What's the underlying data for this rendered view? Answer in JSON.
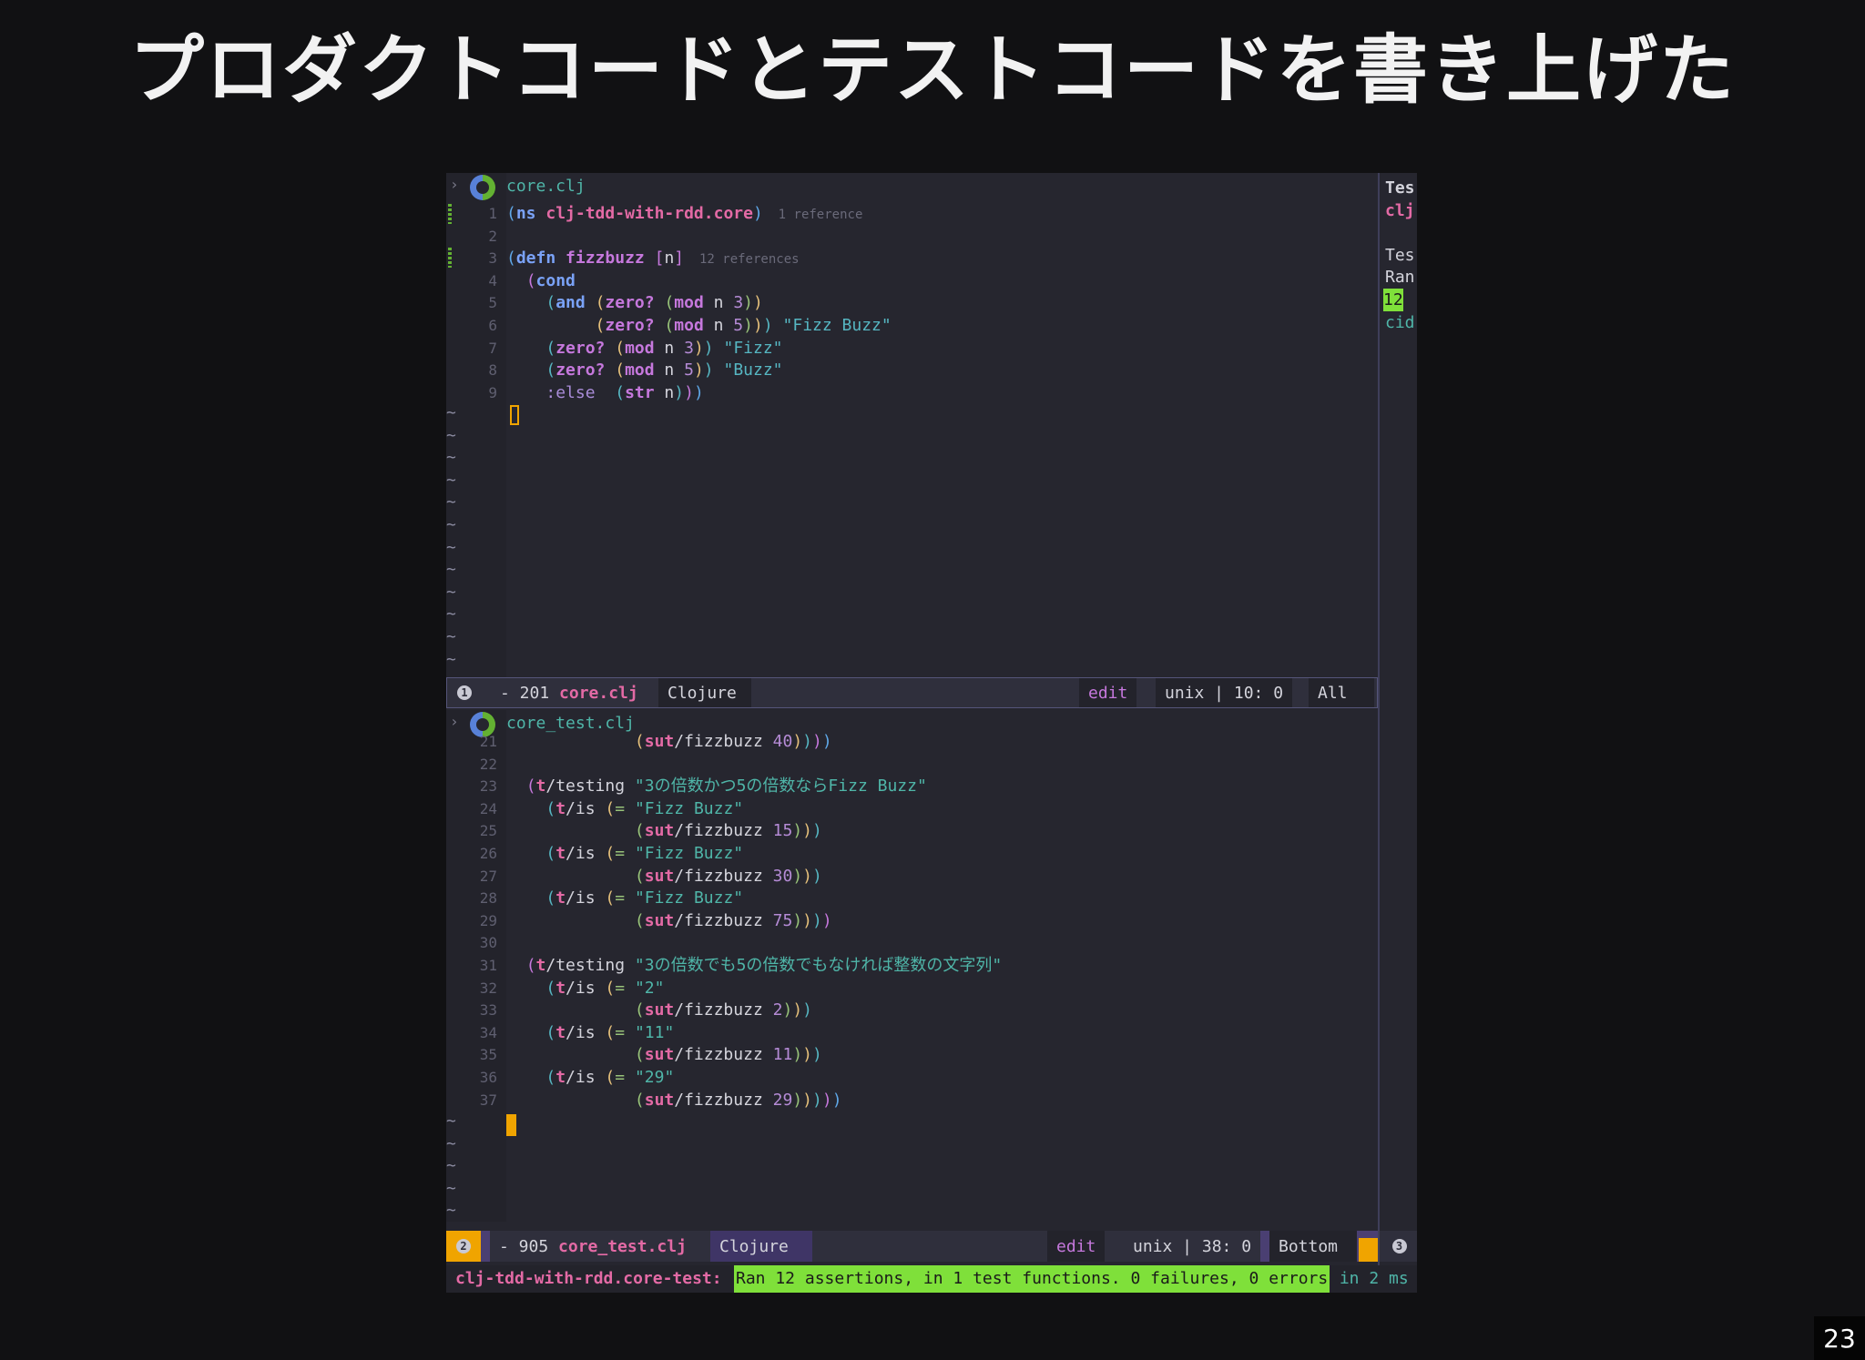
{
  "slide": {
    "title": "プロダクトコードとテストコードを書き上げた",
    "page_number": "23"
  },
  "editor": {
    "top_pane": {
      "file_name": "core.clj",
      "lines": [
        {
          "n": "1",
          "parts": [
            [
              "p1",
              "("
            ],
            [
              "k2",
              "ns"
            ],
            [
              "plain",
              " "
            ],
            [
              "ns",
              "clj-tdd-with-rdd.core"
            ],
            [
              "p1",
              ")"
            ],
            [
              "ref",
              "  1 reference"
            ]
          ]
        },
        {
          "n": "2",
          "parts": []
        },
        {
          "n": "3",
          "parts": [
            [
              "p1",
              "("
            ],
            [
              "k2",
              "defn"
            ],
            [
              "plain",
              " "
            ],
            [
              "f",
              "fizzbuzz"
            ],
            [
              "plain",
              " "
            ],
            [
              "p2",
              "["
            ],
            [
              "plain",
              "n"
            ],
            [
              "p2",
              "]"
            ],
            [
              "ref",
              "  12 references"
            ]
          ]
        },
        {
          "n": "4",
          "parts": [
            [
              "plain",
              "  "
            ],
            [
              "p2",
              "("
            ],
            [
              "k2",
              "cond"
            ]
          ]
        },
        {
          "n": "5",
          "parts": [
            [
              "plain",
              "    "
            ],
            [
              "p3",
              "("
            ],
            [
              "k2",
              "and"
            ],
            [
              "plain",
              " "
            ],
            [
              "p4",
              "("
            ],
            [
              "f",
              "zero?"
            ],
            [
              "plain",
              " "
            ],
            [
              "p5",
              "("
            ],
            [
              "f",
              "mod"
            ],
            [
              "plain",
              " n "
            ],
            [
              "num",
              "3"
            ],
            [
              "p5",
              ")"
            ],
            [
              "p4",
              ")"
            ]
          ]
        },
        {
          "n": "6",
          "parts": [
            [
              "plain",
              "         "
            ],
            [
              "p4",
              "("
            ],
            [
              "f",
              "zero?"
            ],
            [
              "plain",
              " "
            ],
            [
              "p5",
              "("
            ],
            [
              "f",
              "mod"
            ],
            [
              "plain",
              " n "
            ],
            [
              "num",
              "5"
            ],
            [
              "p5",
              ")"
            ],
            [
              "p4",
              ")"
            ],
            [
              "p3",
              ")"
            ],
            [
              "plain",
              " "
            ],
            [
              "s",
              "\"Fizz Buzz\""
            ]
          ]
        },
        {
          "n": "7",
          "parts": [
            [
              "plain",
              "    "
            ],
            [
              "p3",
              "("
            ],
            [
              "f",
              "zero?"
            ],
            [
              "plain",
              " "
            ],
            [
              "p4",
              "("
            ],
            [
              "f",
              "mod"
            ],
            [
              "plain",
              " n "
            ],
            [
              "num",
              "3"
            ],
            [
              "p4",
              ")"
            ],
            [
              "p3",
              ")"
            ],
            [
              "plain",
              " "
            ],
            [
              "s",
              "\"Fizz\""
            ]
          ]
        },
        {
          "n": "8",
          "parts": [
            [
              "plain",
              "    "
            ],
            [
              "p3",
              "("
            ],
            [
              "f",
              "zero?"
            ],
            [
              "plain",
              " "
            ],
            [
              "p4",
              "("
            ],
            [
              "f",
              "mod"
            ],
            [
              "plain",
              " n "
            ],
            [
              "num",
              "5"
            ],
            [
              "p4",
              ")"
            ],
            [
              "p3",
              ")"
            ],
            [
              "plain",
              " "
            ],
            [
              "s",
              "\"Buzz\""
            ]
          ]
        },
        {
          "n": "9",
          "parts": [
            [
              "plain",
              "    "
            ],
            [
              "kw",
              ":else"
            ],
            [
              "plain",
              "  "
            ],
            [
              "p3",
              "("
            ],
            [
              "f",
              "str"
            ],
            [
              "plain",
              " n"
            ],
            [
              "p3",
              ")"
            ],
            [
              "p2",
              ")"
            ],
            [
              "p1",
              ")"
            ]
          ]
        }
      ]
    },
    "top_modeline": {
      "window": "1",
      "size": "- 201 ",
      "file": "core.clj",
      "mode": "Clojure",
      "state": "edit",
      "encoding": "unix | 10: 0",
      "position": "All"
    },
    "bottom_pane": {
      "file_name": "core_test.clj",
      "lines": [
        {
          "n": "21",
          "parts": [
            [
              "plain",
              "             "
            ],
            [
              "p4",
              "("
            ],
            [
              "ns",
              "sut"
            ],
            [
              "plain",
              "/fizzbuzz "
            ],
            [
              "num",
              "40"
            ],
            [
              "p4",
              ")"
            ],
            [
              "p3",
              ")"
            ],
            [
              "p2",
              ")"
            ],
            [
              "p1",
              ")"
            ]
          ]
        },
        {
          "n": "22",
          "parts": []
        },
        {
          "n": "23",
          "parts": [
            [
              "plain",
              "  "
            ],
            [
              "p2",
              "("
            ],
            [
              "ns",
              "t"
            ],
            [
              "plain",
              "/testing "
            ],
            [
              "s2",
              "\"3の倍数かつ5の倍数ならFizz Buzz\""
            ]
          ]
        },
        {
          "n": "24",
          "parts": [
            [
              "plain",
              "    "
            ],
            [
              "p3",
              "("
            ],
            [
              "ns",
              "t"
            ],
            [
              "plain",
              "/is "
            ],
            [
              "p4",
              "("
            ],
            [
              "p5",
              "="
            ],
            [
              "plain",
              " "
            ],
            [
              "s2",
              "\"Fizz Buzz\""
            ]
          ]
        },
        {
          "n": "25",
          "parts": [
            [
              "plain",
              "             "
            ],
            [
              "p5",
              "("
            ],
            [
              "ns",
              "sut"
            ],
            [
              "plain",
              "/fizzbuzz "
            ],
            [
              "num",
              "15"
            ],
            [
              "p5",
              ")"
            ],
            [
              "p4",
              ")"
            ],
            [
              "p3",
              ")"
            ]
          ]
        },
        {
          "n": "26",
          "parts": [
            [
              "plain",
              "    "
            ],
            [
              "p3",
              "("
            ],
            [
              "ns",
              "t"
            ],
            [
              "plain",
              "/is "
            ],
            [
              "p4",
              "("
            ],
            [
              "p5",
              "="
            ],
            [
              "plain",
              " "
            ],
            [
              "s2",
              "\"Fizz Buzz\""
            ]
          ]
        },
        {
          "n": "27",
          "parts": [
            [
              "plain",
              "             "
            ],
            [
              "p5",
              "("
            ],
            [
              "ns",
              "sut"
            ],
            [
              "plain",
              "/fizzbuzz "
            ],
            [
              "num",
              "30"
            ],
            [
              "p5",
              ")"
            ],
            [
              "p4",
              ")"
            ],
            [
              "p3",
              ")"
            ]
          ]
        },
        {
          "n": "28",
          "parts": [
            [
              "plain",
              "    "
            ],
            [
              "p3",
              "("
            ],
            [
              "ns",
              "t"
            ],
            [
              "plain",
              "/is "
            ],
            [
              "p4",
              "("
            ],
            [
              "p5",
              "="
            ],
            [
              "plain",
              " "
            ],
            [
              "s2",
              "\"Fizz Buzz\""
            ]
          ]
        },
        {
          "n": "29",
          "parts": [
            [
              "plain",
              "             "
            ],
            [
              "p5",
              "("
            ],
            [
              "ns",
              "sut"
            ],
            [
              "plain",
              "/fizzbuzz "
            ],
            [
              "num",
              "75"
            ],
            [
              "p5",
              ")"
            ],
            [
              "p4",
              ")"
            ],
            [
              "p3",
              ")"
            ],
            [
              "p2",
              ")"
            ]
          ]
        },
        {
          "n": "30",
          "parts": []
        },
        {
          "n": "31",
          "parts": [
            [
              "plain",
              "  "
            ],
            [
              "p2",
              "("
            ],
            [
              "ns",
              "t"
            ],
            [
              "plain",
              "/testing "
            ],
            [
              "s2",
              "\"3の倍数でも5の倍数でもなければ整数の文字列\""
            ]
          ]
        },
        {
          "n": "32",
          "parts": [
            [
              "plain",
              "    "
            ],
            [
              "p3",
              "("
            ],
            [
              "ns",
              "t"
            ],
            [
              "plain",
              "/is "
            ],
            [
              "p4",
              "("
            ],
            [
              "p5",
              "="
            ],
            [
              "plain",
              " "
            ],
            [
              "s2",
              "\"2\""
            ]
          ]
        },
        {
          "n": "33",
          "parts": [
            [
              "plain",
              "             "
            ],
            [
              "p5",
              "("
            ],
            [
              "ns",
              "sut"
            ],
            [
              "plain",
              "/fizzbuzz "
            ],
            [
              "num",
              "2"
            ],
            [
              "p5",
              ")"
            ],
            [
              "p4",
              ")"
            ],
            [
              "p3",
              ")"
            ]
          ]
        },
        {
          "n": "34",
          "parts": [
            [
              "plain",
              "    "
            ],
            [
              "p3",
              "("
            ],
            [
              "ns",
              "t"
            ],
            [
              "plain",
              "/is "
            ],
            [
              "p4",
              "("
            ],
            [
              "p5",
              "="
            ],
            [
              "plain",
              " "
            ],
            [
              "s2",
              "\"11\""
            ]
          ]
        },
        {
          "n": "35",
          "parts": [
            [
              "plain",
              "             "
            ],
            [
              "p5",
              "("
            ],
            [
              "ns",
              "sut"
            ],
            [
              "plain",
              "/fizzbuzz "
            ],
            [
              "num",
              "11"
            ],
            [
              "p5",
              ")"
            ],
            [
              "p4",
              ")"
            ],
            [
              "p3",
              ")"
            ]
          ]
        },
        {
          "n": "36",
          "parts": [
            [
              "plain",
              "    "
            ],
            [
              "p3",
              "("
            ],
            [
              "ns",
              "t"
            ],
            [
              "plain",
              "/is "
            ],
            [
              "p4",
              "("
            ],
            [
              "p5",
              "="
            ],
            [
              "plain",
              " "
            ],
            [
              "s2",
              "\"29\""
            ]
          ]
        },
        {
          "n": "37",
          "parts": [
            [
              "plain",
              "             "
            ],
            [
              "p5",
              "("
            ],
            [
              "ns",
              "sut"
            ],
            [
              "plain",
              "/fizzbuzz "
            ],
            [
              "num",
              "29"
            ],
            [
              "p5",
              ")"
            ],
            [
              "p4",
              ")"
            ],
            [
              "p3",
              ")"
            ],
            [
              "p2",
              ")"
            ],
            [
              "p1",
              ")"
            ]
          ]
        }
      ]
    },
    "bottom_modeline": {
      "window": "2",
      "size": "- 905 ",
      "file": "core_test.clj",
      "mode": "Clojure",
      "state": "edit",
      "encoding": "unix | 38: 0",
      "position": "Bottom",
      "side_window": "3"
    },
    "side_panel": {
      "lines": [
        "Tes",
        "clj",
        "",
        "Tes",
        "Ran",
        "12",
        "cid"
      ]
    },
    "echo_area": {
      "namespace": "clj-tdd-with-rdd.core-test:",
      "result": "Ran 12 assertions, in 1 test functions. 0 failures, 0 errors",
      "timing": " in 2 ms"
    },
    "colors": {
      "background": "#26262f",
      "success": "#7fe03a",
      "cursor": "#f0a400",
      "accent": "#c678dd"
    }
  }
}
